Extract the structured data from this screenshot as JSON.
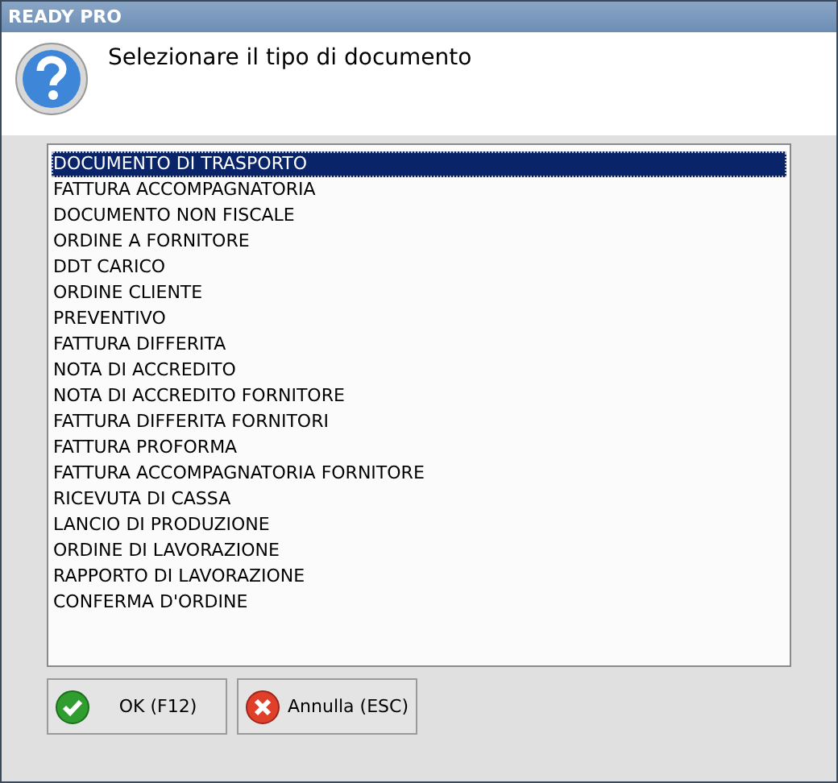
{
  "window": {
    "title": "READY PRO"
  },
  "header": {
    "message": "Selezionare il tipo di documento"
  },
  "list": {
    "items": [
      {
        "label": "DOCUMENTO DI TRASPORTO",
        "selected": true
      },
      {
        "label": "FATTURA ACCOMPAGNATORIA",
        "selected": false
      },
      {
        "label": "DOCUMENTO NON FISCALE",
        "selected": false
      },
      {
        "label": "ORDINE A FORNITORE",
        "selected": false
      },
      {
        "label": "DDT CARICO",
        "selected": false
      },
      {
        "label": "ORDINE CLIENTE",
        "selected": false
      },
      {
        "label": "PREVENTIVO",
        "selected": false
      },
      {
        "label": "FATTURA DIFFERITA",
        "selected": false
      },
      {
        "label": "NOTA DI ACCREDITO",
        "selected": false
      },
      {
        "label": "NOTA DI ACCREDITO FORNITORE",
        "selected": false
      },
      {
        "label": "FATTURA DIFFERITA FORNITORI",
        "selected": false
      },
      {
        "label": "FATTURA PROFORMA",
        "selected": false
      },
      {
        "label": "FATTURA ACCOMPAGNATORIA FORNITORE",
        "selected": false
      },
      {
        "label": "RICEVUTA DI CASSA",
        "selected": false
      },
      {
        "label": "LANCIO DI PRODUZIONE",
        "selected": false
      },
      {
        "label": "ORDINE DI LAVORAZIONE",
        "selected": false
      },
      {
        "label": "RAPPORTO DI LAVORAZIONE",
        "selected": false
      },
      {
        "label": "CONFERMA D'ORDINE",
        "selected": false
      }
    ]
  },
  "buttons": [
    {
      "label": "OK (F12)",
      "kind": "ok"
    },
    {
      "label": "Annulla (ESC)",
      "kind": "cancel"
    }
  ]
}
